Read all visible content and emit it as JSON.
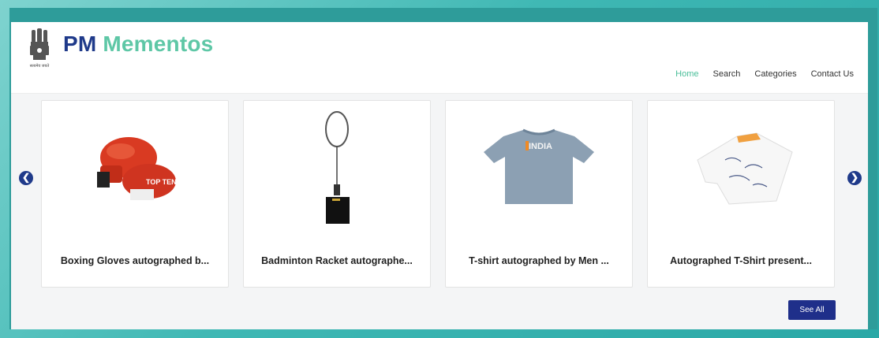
{
  "brand": {
    "title_part1": "PM",
    "title_part2": "Mementos",
    "emblem_caption": "सत्यमेव जयते"
  },
  "nav": {
    "items": [
      "Home",
      "Search",
      "Categories",
      "Contact Us"
    ],
    "active": "Home"
  },
  "carousel": {
    "prev_icon": "chevron-left-icon",
    "next_icon": "chevron-right-icon",
    "cards": [
      {
        "title": "Boxing Gloves autographed b...",
        "image": "boxing-gloves"
      },
      {
        "title": "Badminton Racket autographe...",
        "image": "badminton-racket"
      },
      {
        "title": "T-shirt autographed by Men ...",
        "image": "india-tshirt",
        "shirt_text": "INDIA"
      },
      {
        "title": "Autographed T-Shirt present...",
        "image": "white-tshirt"
      }
    ]
  },
  "see_all_label": "See All",
  "colors": {
    "brand_blue": "#1f3a8a",
    "brand_green": "#5ec7a6",
    "frame_teal": "#2e9c9a",
    "button_navy": "#1f2f8a"
  }
}
